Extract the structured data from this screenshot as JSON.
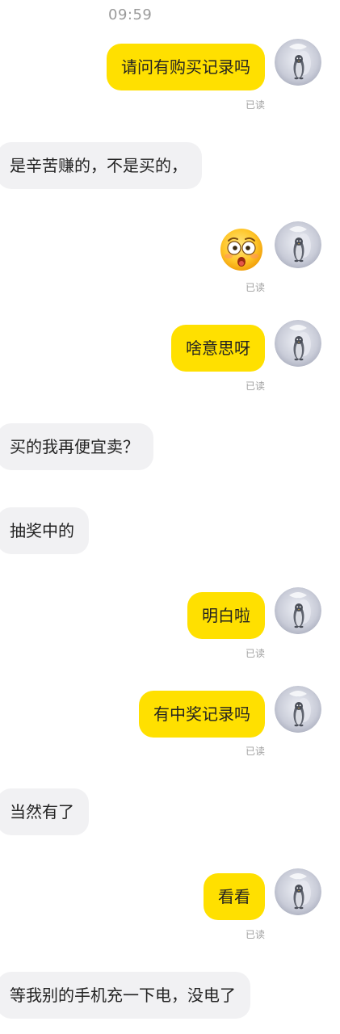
{
  "header": {
    "time": "09:59"
  },
  "read_label": "已读",
  "messages": [
    {
      "text": "请问有购买记录吗"
    },
    {
      "text": "是辛苦赚的，不是买的，"
    },
    {
      "emoji": "astonished-face"
    },
    {
      "text": "啥意思呀"
    },
    {
      "text": "买的我再便宜卖？"
    },
    {
      "text": "抽奖中的"
    },
    {
      "text": "明白啦"
    },
    {
      "text": "有中奖记录吗"
    },
    {
      "text": "当然有了"
    },
    {
      "text": "看看"
    },
    {
      "text": "等我别的手机充一下电，没电了"
    }
  ],
  "colors": {
    "outgoing_bubble": "#ffe000",
    "incoming_bubble": "#f1f1f3",
    "background": "#ffffff"
  }
}
